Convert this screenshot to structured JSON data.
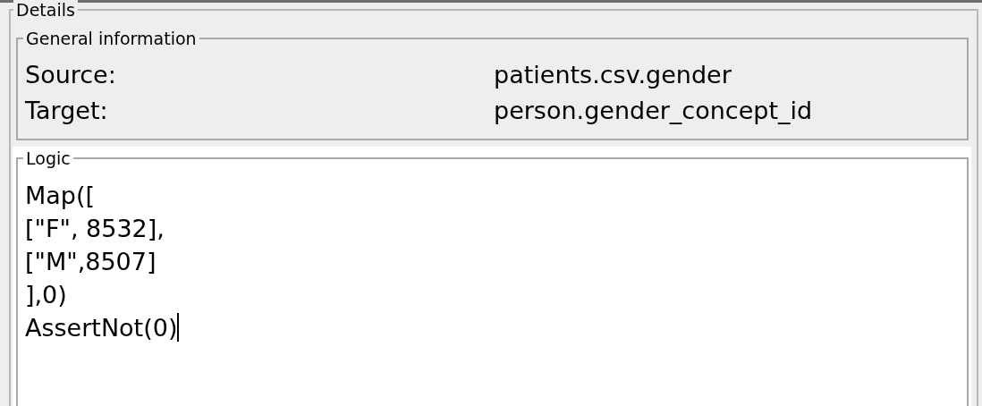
{
  "details": {
    "title": "Details",
    "general_information": {
      "title": "General information",
      "fields": [
        {
          "label": "Source:",
          "value": "patients.csv.gender"
        },
        {
          "label": "Target:",
          "value": "person.gender_concept_id"
        }
      ]
    },
    "logic": {
      "title": "Logic",
      "lines": [
        "Map([",
        "[\"F\", 8532],",
        "[\"M\",8507]",
        "],0)",
        "AssertNot(0)"
      ]
    }
  }
}
